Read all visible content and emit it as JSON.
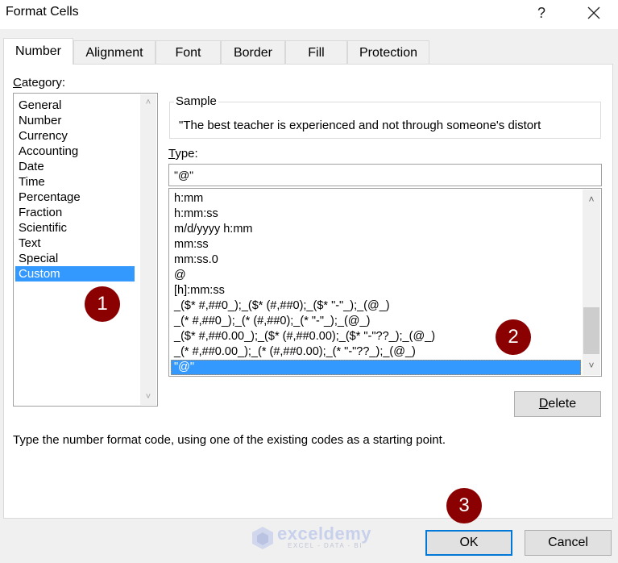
{
  "window": {
    "title": "Format Cells",
    "help_label": "?",
    "close_icon": "close-icon"
  },
  "tabs": [
    {
      "label": "Number",
      "active": true
    },
    {
      "label": "Alignment",
      "active": false
    },
    {
      "label": "Font",
      "active": false
    },
    {
      "label": "Border",
      "active": false
    },
    {
      "label": "Fill",
      "active": false
    },
    {
      "label": "Protection",
      "active": false
    }
  ],
  "category": {
    "label_first": "C",
    "label_rest": "ategory:",
    "items": [
      "General",
      "Number",
      "Currency",
      "Accounting",
      "Date",
      "Time",
      "Percentage",
      "Fraction",
      "Scientific",
      "Text",
      "Special",
      "Custom"
    ],
    "selected": "Custom"
  },
  "sample": {
    "legend": "Sample",
    "text": "\"The best teacher is experienced and not through someone's distort"
  },
  "type": {
    "label_first": "T",
    "label_rest": "ype:",
    "value": "\"@\"",
    "items": [
      "h:mm",
      "h:mm:ss",
      "m/d/yyyy h:mm",
      "mm:ss",
      "mm:ss.0",
      "@",
      "[h]:mm:ss",
      "_($* #,##0_);_($* (#,##0);_($* \"-\"_);_(@_)",
      "_(* #,##0_);_(* (#,##0);_(* \"-\"_);_(@_)",
      "_($* #,##0.00_);_($* (#,##0.00);_($* \"-\"??_);_(@_)",
      "_(* #,##0.00_);_(* (#,##0.00);_(* \"-\"??_);_(@_)",
      "\"@\""
    ],
    "selected": "\"@\""
  },
  "delete_button": {
    "first": "D",
    "rest": "elete"
  },
  "description": "Type the number format code, using one of the existing codes as a starting point.",
  "ok_label": "OK",
  "cancel_label": "Cancel",
  "step_badges": [
    "1",
    "2",
    "3"
  ],
  "watermark": {
    "name": "exceldemy",
    "tagline": "EXCEL - DATA - BI"
  },
  "colors": {
    "selection": "#3399ff",
    "badge": "#8b0000",
    "default_button_border": "#0078d7"
  }
}
